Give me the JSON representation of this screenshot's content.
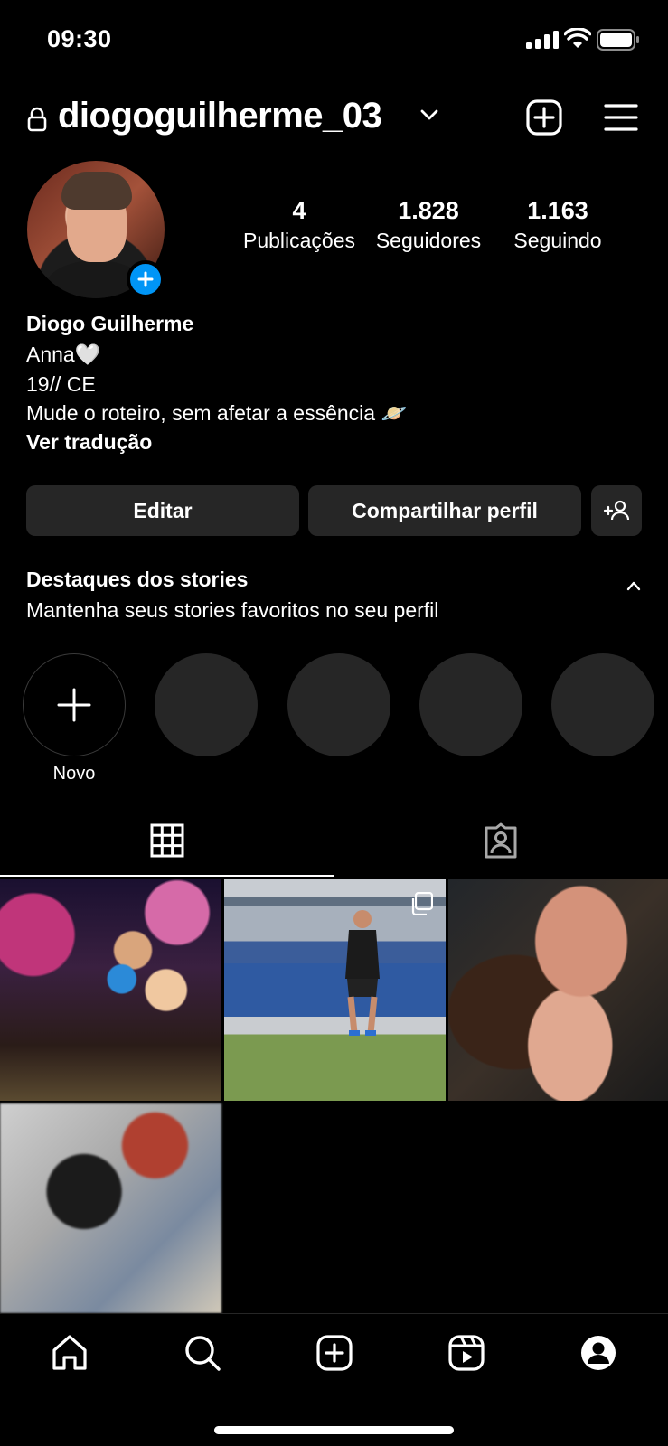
{
  "status_bar": {
    "time": "09:30"
  },
  "header": {
    "username": "diogoguilherme_03"
  },
  "profile": {
    "stats": [
      {
        "value": "4",
        "label": "Publicações"
      },
      {
        "value": "1.828",
        "label": "Seguidores"
      },
      {
        "value": "1.163",
        "label": "Seguindo"
      }
    ],
    "name": "Diogo Guilherme",
    "bio_lines": [
      "Anna🤍",
      "19// CE",
      "Mude o roteiro, sem afetar a essência 🪐"
    ],
    "translate": "Ver tradução"
  },
  "actions": {
    "edit": "Editar",
    "share": "Compartilhar perfil"
  },
  "highlights": {
    "title": "Destaques dos stories",
    "subtitle": "Mantenha seus stories favoritos no seu perfil",
    "new_label": "Novo"
  },
  "colors": {
    "background": "#000000",
    "button": "#262626",
    "accent": "#0095f6"
  },
  "icons": [
    "lock-icon",
    "chevron-down-icon",
    "create-icon",
    "menu-icon",
    "grid-icon",
    "tagged-icon",
    "home-icon",
    "search-icon",
    "reels-icon",
    "profile-icon"
  ]
}
